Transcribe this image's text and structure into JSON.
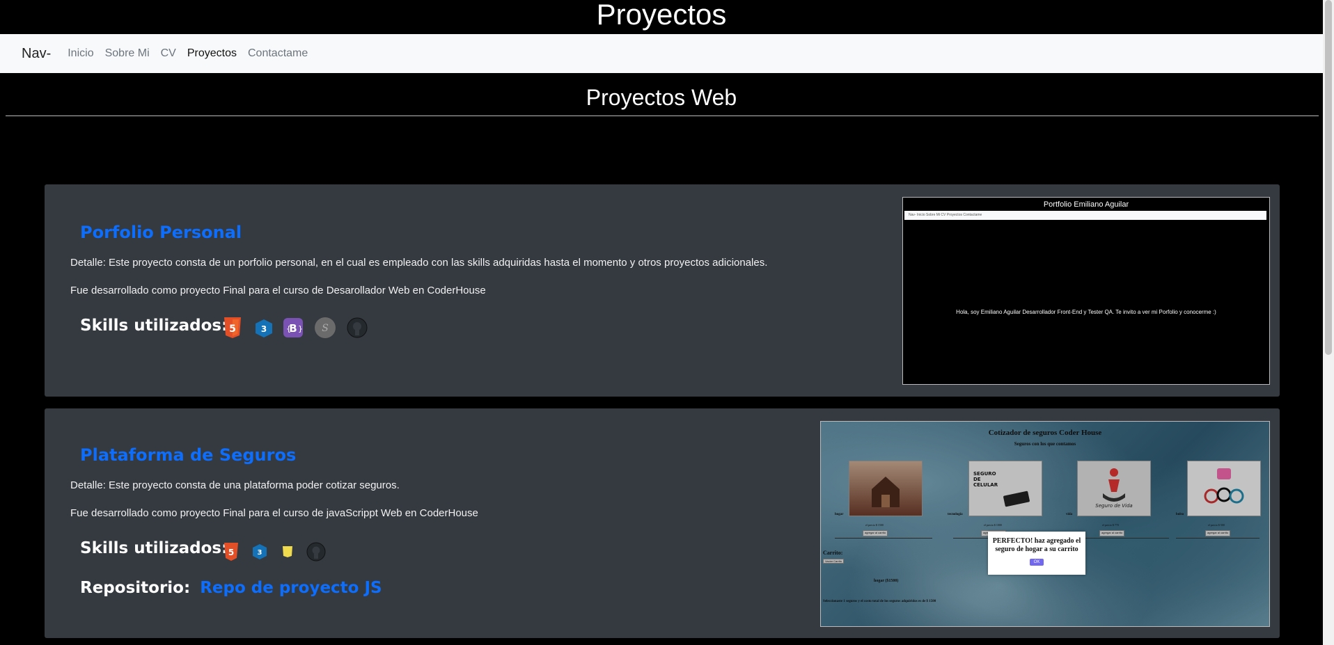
{
  "header": {
    "title": "Proyectos"
  },
  "navbar": {
    "brand": "Nav-",
    "links": [
      "Inicio",
      "Sobre Mi",
      "CV",
      "Proyectos",
      "Contactame"
    ],
    "active": "Proyectos"
  },
  "section": {
    "title": "Proyectos Web"
  },
  "projects": [
    {
      "title": "Porfolio Personal",
      "detail": "Detalle: Este proyecto consta de un porfolio personal, en el cual es empleado con las skills adquiridas hasta el momento y otros proyectos adicionales.",
      "course": "Fue desarrollado como proyecto Final para el curso de Desarollador Web en CoderHouse",
      "skills_label": "Skills utilizados:",
      "skills": [
        "html5-icon",
        "css3-icon",
        "bootstrap-icon",
        "sass-icon",
        "github-icon"
      ],
      "screenshot": {
        "title": "Portfolio Emiliano Aguilar",
        "nav": "Nav-   Inicio   Sobre Mi   CV   Proyectos   Contactame",
        "body": "Hola, soy Emiliano Aguilar Desarrollador Front-End y Tester QA. Te invito a ver mi Porfolio y conocerme :)"
      }
    },
    {
      "title": "Plataforma de Seguros",
      "detail": "Detalle: Este proyecto consta de una plataforma poder cotizar seguros.",
      "course": "Fue desarrollado como proyecto Final para el curso de javaScrippt Web en CoderHouse",
      "skills_label": "Skills utilizados:",
      "skills": [
        "html5-icon",
        "css3-icon",
        "javascript-icon",
        "github-icon"
      ],
      "repo_label": "Repositorio:",
      "repo_link": "Repo de proyecto JS",
      "screenshot": {
        "title": "Cotizador de seguros Coder House",
        "subtitle": "Seguros con los que contamos",
        "categories": [
          "hogar",
          "tecnologia",
          "vida",
          "bolso"
        ],
        "prices": [
          "el precio $ 1500",
          "el precio $ 1000",
          "el precio $ 770",
          "el precio $ 500"
        ],
        "add_label": "agregar al carrito",
        "item_labels": [
          "",
          "SEGURO DE CELULAR",
          "Seguro de Vida",
          ""
        ],
        "cart_label": "Carrito:",
        "empty_label": "Vaciar Carrito",
        "cart_item": "hogar ($1500)",
        "total": "Seleccionaste 1 seguros y el costo total de los seguros adquiridos es de $ 1500",
        "modal_text": "PERFECTO! haz agregado el seguro de hogar a su carrito",
        "modal_ok": "OK"
      }
    }
  ],
  "colors": {
    "accent": "#0d6efd",
    "card_bg": "#343a40",
    "navbar_bg": "#f8f9fa"
  }
}
